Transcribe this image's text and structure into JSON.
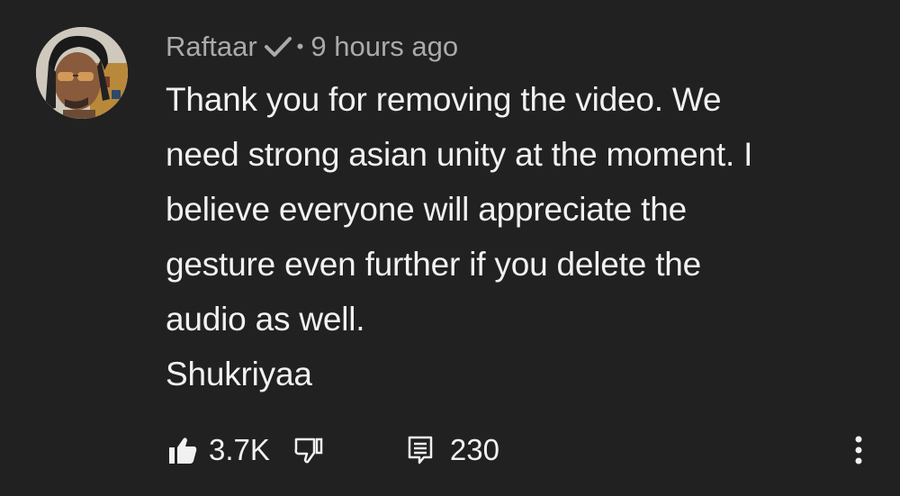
{
  "comment": {
    "author": "Raftaar",
    "verified": true,
    "separator": "•",
    "time": "9 hours ago",
    "text": "Thank you for removing the video. We\nneed strong asian unity at the moment. I\nbelieve everyone will appreciate the\ngesture even further if you delete the\naudio as well.\nShukriyaa",
    "like_count": "3.7K",
    "reply_count": "230"
  },
  "icons": {
    "avatar": "avatar",
    "verified": "check-icon",
    "like": "thumbs-up-icon",
    "dislike": "thumbs-down-icon",
    "replies": "reply-comment-icon",
    "menu": "more-vertical-icon"
  },
  "colors": {
    "background": "#212121",
    "text_primary": "#f1f1f1",
    "text_secondary": "#aaaaaa"
  }
}
